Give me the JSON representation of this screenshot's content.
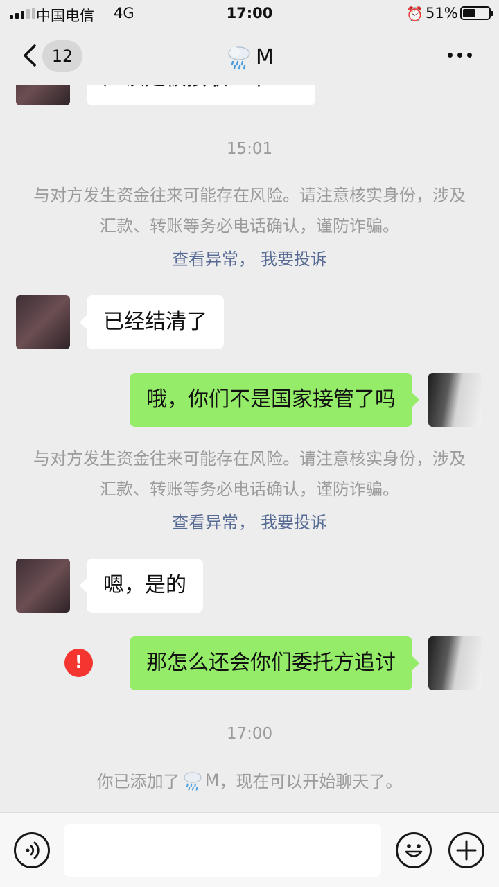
{
  "status_bar": {
    "carrier": "中国电信",
    "network": "4G",
    "time": "17:00",
    "battery_percent": "51%",
    "battery_level": 0.51,
    "icons": [
      "signal-icon",
      "alarm-icon",
      "battery-icon"
    ]
  },
  "navbar": {
    "unread_count": "12",
    "contact_name": "M",
    "icons": [
      "back-chevron-icon",
      "rain-cloud-icon",
      "more-icon"
    ]
  },
  "chat": {
    "partial_message": "应该是被接收一下",
    "timestamp_1": "15:01",
    "risk_notice_1": "与对方发生资金往来可能存在风险。请注意核实身份，涉及汇款、转账等务必电话确认，谨防诈骗。",
    "notice_link_view_1": "查看异常",
    "notice_link_sep_1": "，",
    "notice_link_report_1": "我要投诉",
    "msg_1": "已经结清了",
    "msg_2": "哦，你们不是国家接管了吗",
    "risk_notice_2": "与对方发生资金往来可能存在风险。请注意核实身份，涉及汇款、转账等务必电话确认，谨防诈骗。",
    "notice_link_view_2": "查看异常",
    "notice_link_sep_2": "，",
    "notice_link_report_2": "我要投诉",
    "msg_3": "嗯，是的",
    "msg_4": "那怎么还会你们委托方追讨",
    "msg_4_error": "!",
    "timestamp_2": "17:00",
    "added_prefix": "你已添加了",
    "added_name": "M",
    "added_suffix": "，现在可以开始聊天了。"
  },
  "inputbar": {
    "icons": [
      "voice-icon",
      "emoji-icon",
      "plus-icon"
    ],
    "input_value": ""
  },
  "colors": {
    "background": "#ededed",
    "bubble_incoming": "#ffffff",
    "bubble_outgoing": "#95ec69",
    "link": "#576b95",
    "error": "#f43530"
  }
}
